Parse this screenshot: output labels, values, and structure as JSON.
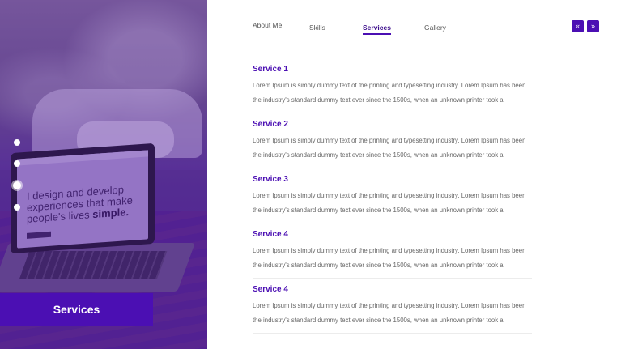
{
  "hero": {
    "laptop_text_line1": "I design and develop",
    "laptop_text_line2": "experiences that make",
    "laptop_text_line3": "people's lives",
    "laptop_text_bold": "simple.",
    "section_title": "Services"
  },
  "dots": [
    {
      "label": "dot-1"
    },
    {
      "label": "dot-2"
    },
    {
      "label": "dot-3"
    },
    {
      "label": "dot-4"
    }
  ],
  "nav": {
    "items": [
      {
        "label": "About Me"
      },
      {
        "label": "Skills"
      },
      {
        "label": "Services"
      },
      {
        "label": "Gallery"
      }
    ],
    "active": "Services",
    "prev_icon": "«",
    "next_icon": "»"
  },
  "services": [
    {
      "title": "Service 1",
      "text": "Lorem Ipsum is simply dummy text of the printing and typesetting industry. Lorem Ipsum has been the industry's standard dummy text ever since the 1500s, when an unknown printer took a"
    },
    {
      "title": "Service 2",
      "text": "Lorem Ipsum is simply dummy text of the printing and typesetting industry. Lorem Ipsum has been the industry's standard dummy text ever since the 1500s, when an unknown printer took a"
    },
    {
      "title": "Service 3",
      "text": "Lorem Ipsum is simply dummy text of the printing and typesetting industry. Lorem Ipsum has been the industry's standard dummy text ever since the 1500s, when an unknown printer took a"
    },
    {
      "title": "Service 4",
      "text": "Lorem Ipsum is simply dummy text of the printing and typesetting industry. Lorem Ipsum has been the industry's standard dummy text ever since the 1500s, when an unknown printer took a"
    },
    {
      "title": "Service 4",
      "text": "Lorem Ipsum is simply dummy text of the printing and typesetting industry. Lorem Ipsum has been the industry's standard dummy text ever since the 1500s, when an unknown printer took a"
    }
  ],
  "colors": {
    "accent": "#4b0fb3",
    "heading": "#4b0fb3",
    "body_text": "#666666"
  }
}
